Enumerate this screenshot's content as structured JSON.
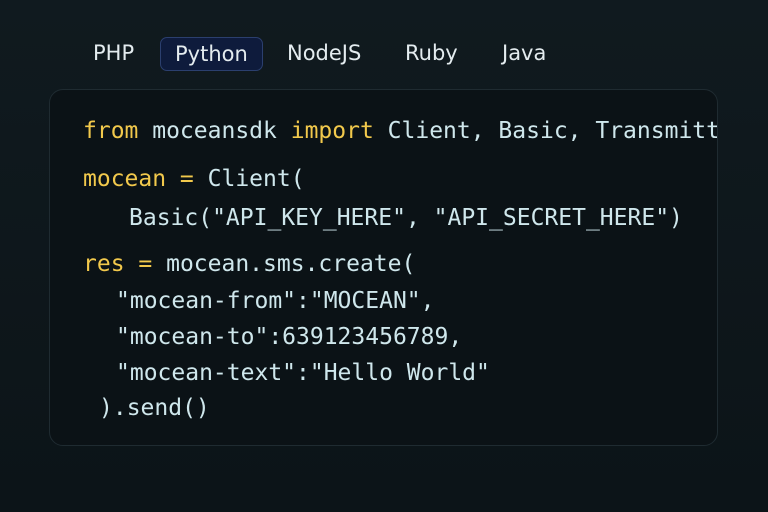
{
  "tabs": {
    "items": [
      {
        "label": "PHP"
      },
      {
        "label": "Python"
      },
      {
        "label": "NodeJS"
      },
      {
        "label": "Ruby"
      },
      {
        "label": "Java"
      }
    ],
    "active": "Python"
  },
  "code": {
    "line1": {
      "kw1": "from",
      "mid": " moceansdk ",
      "kw2": "import",
      "rest": " Client, Basic, Transmitt"
    },
    "line2": {
      "kw": "mocean =",
      "rest": " Client("
    },
    "line3": {
      "text": "Basic(\"API_KEY_HERE\", \"API_SECRET_HERE\")"
    },
    "line4": {
      "kw": "res =",
      "rest": " mocean.sms.create("
    },
    "line5": {
      "text": "\"mocean-from\":\"MOCEAN\","
    },
    "line6": {
      "text": "\"mocean-to\":639123456789,"
    },
    "line7": {
      "text": "\"mocean-text\":\"Hello World\""
    },
    "line8": {
      "text": ").send()"
    }
  },
  "colors": {
    "background": "#0f181c",
    "panel": "#0b1216",
    "keyword": "#f2c94c",
    "code_text": "#cfe7ec",
    "active_tab": "#0e1b3c"
  }
}
